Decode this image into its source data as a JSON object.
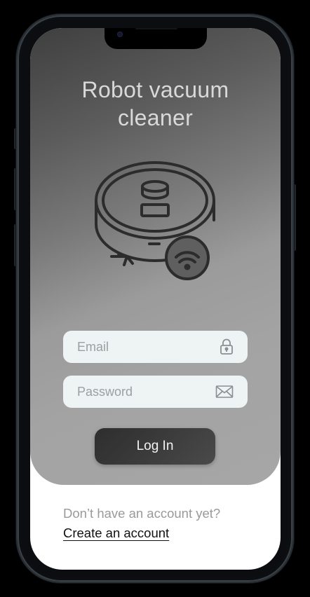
{
  "app": {
    "title": "Robot vacuum\ncleaner"
  },
  "login_form": {
    "email_placeholder": "Email",
    "password_placeholder": "Password",
    "email_icon": "lock-icon",
    "password_icon": "envelope-icon",
    "login_label": "Log In"
  },
  "signup": {
    "prompt": "Don’t have an account yet?",
    "link_label": "Create an account"
  },
  "illustration": {
    "name": "robot-vacuum-wifi-icon"
  },
  "colors": {
    "hero_gradient_dark": "#3f3f3f",
    "hero_gradient_light": "#a6a6a6",
    "field_background": "#eef3f3",
    "button_background": "#333333",
    "button_text": "#f2f2f2",
    "page_background": "#ffffff"
  }
}
